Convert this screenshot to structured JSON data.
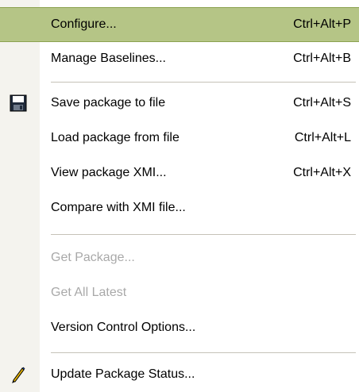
{
  "menu": {
    "items": [
      {
        "label": "Configure...",
        "shortcut": "Ctrl+Alt+P"
      },
      {
        "label": "Manage Baselines...",
        "shortcut": "Ctrl+Alt+B"
      },
      {
        "label": "Save package to file",
        "shortcut": "Ctrl+Alt+S",
        "icon": "floppy-disk-icon"
      },
      {
        "label": "Load package from file",
        "shortcut": "Ctrl+Alt+L"
      },
      {
        "label": "View package XMI...",
        "shortcut": "Ctrl+Alt+X"
      },
      {
        "label": "Compare with XMI file..."
      },
      {
        "label": "Get Package...",
        "state": "disabled"
      },
      {
        "label": "Get All Latest",
        "state": "disabled"
      },
      {
        "label": "Version Control Options..."
      },
      {
        "label": "Update Package Status...",
        "icon": "pencil-icon"
      }
    ],
    "selected_item": "Configure..."
  },
  "colors": {
    "highlight": "#b5c586",
    "gutter": "#f4f3ee",
    "separator": "#c5c2b8",
    "disabled_text": "#a9a9a9"
  }
}
